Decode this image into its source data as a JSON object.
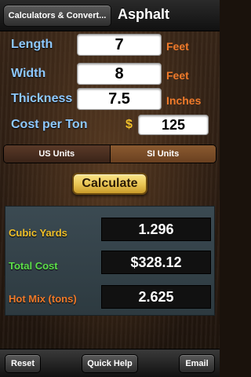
{
  "nav": {
    "back_label": "Calculators & Convert...",
    "title": "Asphalt"
  },
  "inputs": {
    "length": {
      "label": "Length",
      "value": "7",
      "unit": "Feet"
    },
    "width": {
      "label": "Width",
      "value": "8",
      "unit": "Feet"
    },
    "thickness": {
      "label": "Thickness",
      "value": "7.5",
      "unit": "Inches"
    },
    "cost": {
      "label": "Cost per Ton",
      "currency": "$",
      "value": "125"
    }
  },
  "units": {
    "us_label": "US Units",
    "si_label": "SI Units",
    "selected": "SI Units"
  },
  "calculate_label": "Calculate",
  "results": {
    "cubic_yards": {
      "label": "Cubic Yards",
      "value": "1.296",
      "color": "#f0c02a"
    },
    "total_cost": {
      "label": "Total Cost",
      "value": "$328.12",
      "color": "#5de04a"
    },
    "hot_mix": {
      "label": "Hot Mix (tons)",
      "value": "2.625",
      "color": "#f07a2a"
    }
  },
  "toolbar": {
    "reset_label": "Reset",
    "quick_help_label": "Quick Help",
    "email_label": "Email"
  },
  "colors": {
    "label_blue": "#8ec9ff",
    "unit_orange": "#f07a2a",
    "calculate_gold": "#e8c453"
  }
}
